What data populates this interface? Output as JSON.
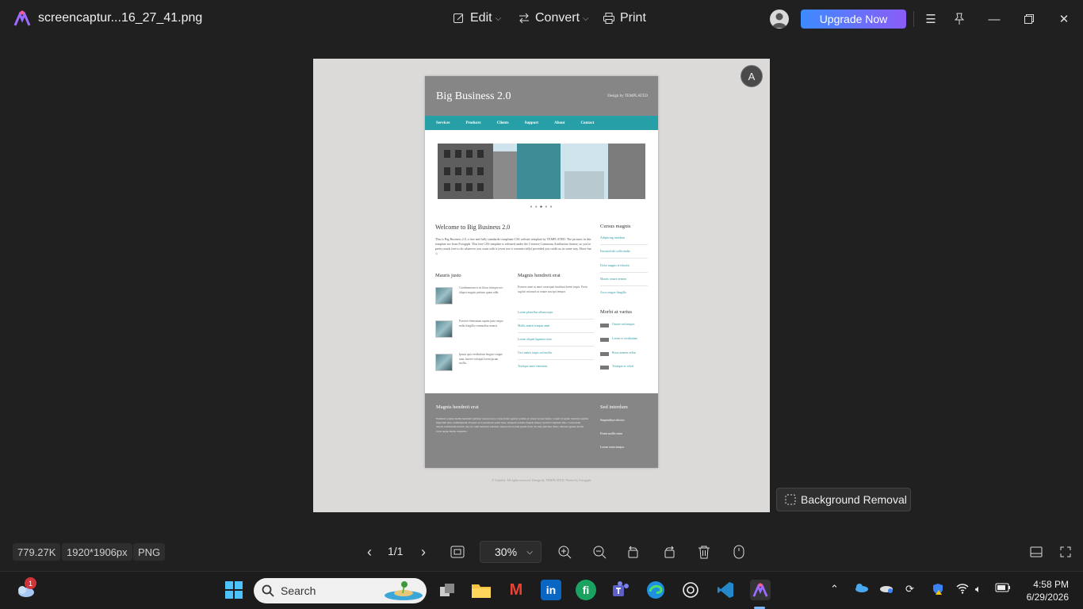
{
  "app": {
    "file_name": "screencaptur...16_27_41.png",
    "menu": {
      "edit": "Edit",
      "convert": "Convert",
      "print": "Print"
    },
    "upgrade_label": "Upgrade Now",
    "background_removal_label": "Background Removal"
  },
  "image_content": {
    "site_title": "Big Business 2.0",
    "site_credit": "Design by TEMPLATED",
    "nav": [
      "Services",
      "Products",
      "Clients",
      "Support",
      "About",
      "Contact"
    ],
    "welcome_heading": "Welcome to Big Business 2.0",
    "intro": "This is Big Business 2.0, a free and fully standards-compliant CSS website template by TEMPLATED. The pictures in this template are from Fotogrph. This free CSS template is released under the Creative Commons Attribution license, so you're pretty much free to do whatever you want with it (even use it commercially) provided you credit us in some way. Have fun :)",
    "col1_heading": "Mauris justo",
    "col1_items": [
      "Condimentum et eu litora tristique nec aliquet magnis pretium quam nibh.",
      "Posuere elementum sapien justo neque nulla fringilla commodius mauris.",
      "Ipsum quis vestibulum feugiat congue nunc laoreet volutpat lorem ipsum mollis."
    ],
    "col2_heading": "Magnis hendreit erat",
    "col2_text": "Posuere amet ut amet consequat tincidunt lorem turpis. Proin sagittis euismod ut ornare suscipit tempor.",
    "col2_links": [
      "Lorem phasellus ullamcorper",
      "Mollis mattis tempus amet",
      "Lorem aliquet ligamen vitae",
      "Orci mattis turpis sed mollis",
      "Tristique amet venenatis"
    ],
    "side1_heading": "Cursus magnis",
    "side1_links": [
      "Adipiscing tincidunt",
      "Euismod ulti sollicitudin",
      "Dolor magnis et lobortis",
      "Mauris ornare aenean",
      "Arcu congue fringilla"
    ],
    "side2_heading": "Morbi at varius",
    "side2_links": [
      "Ornare sed tempus",
      "Lorem et vestibulum",
      "Risus aenean vellus",
      "Tristique at veloit"
    ],
    "footer_heading": "Magnis hendreit erat",
    "footer_text": "Euismod sodales mollis hendrerit pulvinar aenean urna. Consectetur egestas sodales et ornare laoreet turpis. Lorem id sapien vehicula sagittis imperdiet urna condimentum. Posuere arcu parturient quam risus. Aliquam sodales magnis tempor gravida vulputate felis. Consectetur mauris sollicitudin dictum. Auctor enim hendrerit pulvinar aenean urna lorem ipsum dolor sit amet pulvinar libero. Mauris egestas mollis lacus augue mattis venenatis.",
    "footer_side_heading": "Sed interdum",
    "footer_side_links": [
      "Suspendisse ultrices",
      "Fermt mollis enim",
      "Lorem enim tempor"
    ],
    "copyright": "© Untitled. All rights reserved. Design by TEMPLATED. Photos by Fotogrph."
  },
  "status": {
    "file_size": "779.27K",
    "dimensions": "1920*1906px",
    "format": "PNG",
    "page": "1/1",
    "zoom": "30%"
  },
  "taskbar": {
    "search_placeholder": "Search",
    "weather_badge": "1",
    "time": "4:58 PM",
    "date": "6/29/2026"
  },
  "colors": {
    "accent": "#26a0a6",
    "upgrade_start": "#3d8bff",
    "upgrade_end": "#8a5cf6"
  }
}
